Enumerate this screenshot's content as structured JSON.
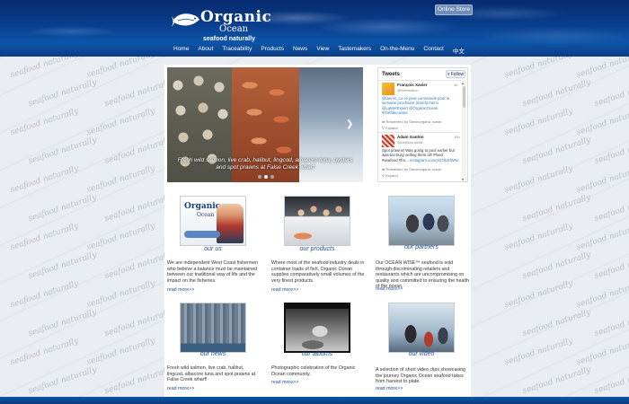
{
  "header": {
    "logo_line1": "Organic",
    "logo_line2": "Ocean",
    "tagline": "seafood naturally",
    "store_button": "Online Store"
  },
  "nav": [
    "Home",
    "About",
    "Traceability",
    "Products",
    "News",
    "View",
    "Tastemakers",
    "On-the-Menu",
    "Contact",
    "中文"
  ],
  "watermark": "seafood naturally",
  "slider": {
    "caption": "Fresh wild salmon, live crab, halibut, lingcod, albacore tuna, oysters and spot prawns at False Creek wharf"
  },
  "tweets": {
    "title": "Tweets",
    "follow": "Follow",
    "items": [
      {
        "name": "François Xavier",
        "handle": "@foxbrealion",
        "time": "4h",
        "text": "@tannin_co on peut commande pour la semaine prochaine (mardi) merci",
        "links": "@LaMerExpert @OrganicOcean #chefdecuisine",
        "retweeted": "Retweeted by Steve/organic ocean",
        "expand": "Expand"
      },
      {
        "name": "Adam Ganton",
        "handle": "@chillsoundsoft",
        "time": "10h",
        "text": "Spot prawns! Was going to pool earlier but was too busy selling them all! #food #seafood #fro...",
        "links": "instagram.com/p/ZOk2lIWNr",
        "retweeted": "Retweeted by Steve/organic ocean",
        "expand": "Expand"
      }
    ]
  },
  "sections": [
    {
      "title": "our us",
      "description": "We are independent West Coast fishermen who believe a balance must be maintained between our traditional way of life and the impact on the fisheries.",
      "more": "read more>>"
    },
    {
      "title": "our products",
      "description": "Where most of the seafood industry deals in container loads of fish, Organic Ocean supplies comparatively small volumes of the very finest products.",
      "more": "read more>>"
    },
    {
      "title": "our partners",
      "description": "Our OCEAN WISE™ seafood is sold through discriminating retailers and restaurants which are uncompromising on quality and committed to ensuring the health of the ocean.",
      "more": "read more>>"
    },
    {
      "title": "our news",
      "description": "Fresh wild salmon, live crab, halibut, lingcod, albacore tuna and spot prawns at False Creek wharf!",
      "more": "read more>>"
    },
    {
      "title": "our albums",
      "description": "Photographic celebration of the Organic Ocean community.",
      "more": "read more>>"
    },
    {
      "title": "our video",
      "description": "A selection of short video clips showcasing the journey Organic Ocean seafood takes from harvest to plate.",
      "more": "read more>>"
    }
  ],
  "colors": {
    "header_blue": "#0a3f8f",
    "link_blue": "#1f4f9a",
    "twitter_blue": "#2b7bb9"
  }
}
